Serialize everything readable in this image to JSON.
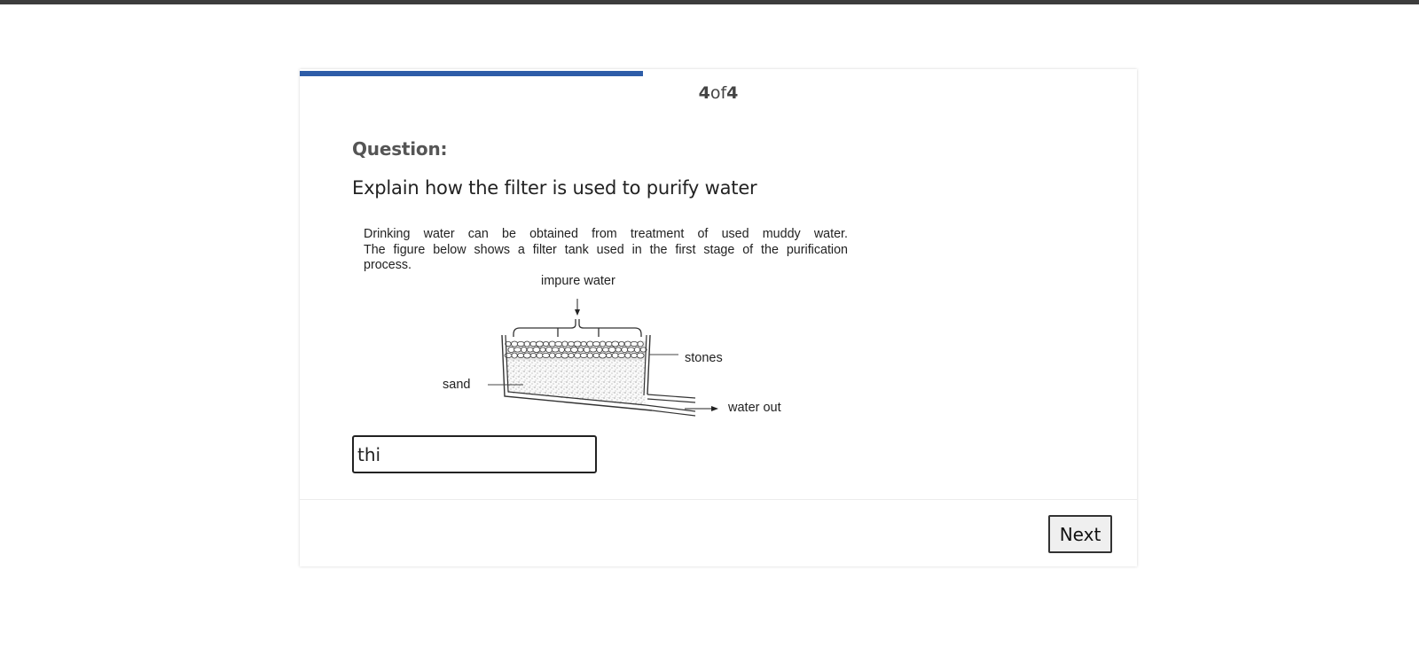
{
  "colors": {
    "accent": "#2e5da8",
    "top_bar": "#3d3d3d"
  },
  "progress": {
    "current": "4",
    "of_text": "of",
    "total": "4",
    "fraction": 0.41
  },
  "question": {
    "heading": "Question:",
    "text": "Explain how the filter is used to purify water"
  },
  "figure": {
    "lines": [
      "Drinking water can be obtained from treatment of used muddy water.",
      "The figure below shows a filter tank used in the first stage of the purification",
      "process."
    ],
    "labels": {
      "impure_water": "impure water",
      "stones": "stones",
      "sand": "sand",
      "water_out": "water out"
    }
  },
  "answer": {
    "value": "thi",
    "placeholder": ""
  },
  "footer": {
    "next_label": "Next"
  }
}
